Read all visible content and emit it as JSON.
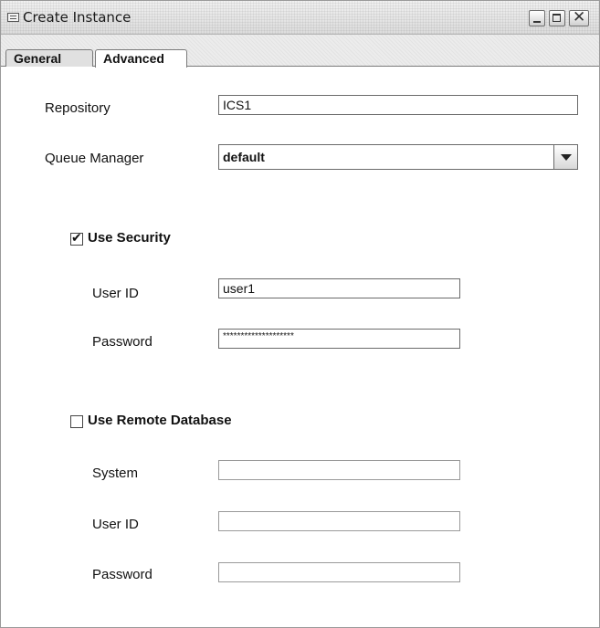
{
  "window": {
    "title": "Create Instance"
  },
  "tabs": [
    {
      "label": "General"
    },
    {
      "label": "Advanced"
    }
  ],
  "form": {
    "repository_label": "Repository",
    "repository_value": "ICS1",
    "queue_manager_label": "Queue Manager",
    "queue_manager_value": "default",
    "use_security": {
      "label": "Use Security",
      "checked": true,
      "user_id_label": "User ID",
      "user_id_value": "user1",
      "password_label": "Password",
      "password_value": "********************"
    },
    "use_remote_database": {
      "label": "Use Remote Database",
      "checked": false,
      "system_label": "System",
      "system_value": "",
      "user_id_label": "User ID",
      "user_id_value": "",
      "password_label": "Password",
      "password_value": ""
    }
  },
  "icons": {
    "app": "window-icon",
    "minimize": "minimize-icon",
    "maximize": "maximize-icon",
    "close": "close-icon",
    "dropdown": "chevron-down-icon",
    "check": "checkmark-icon"
  }
}
